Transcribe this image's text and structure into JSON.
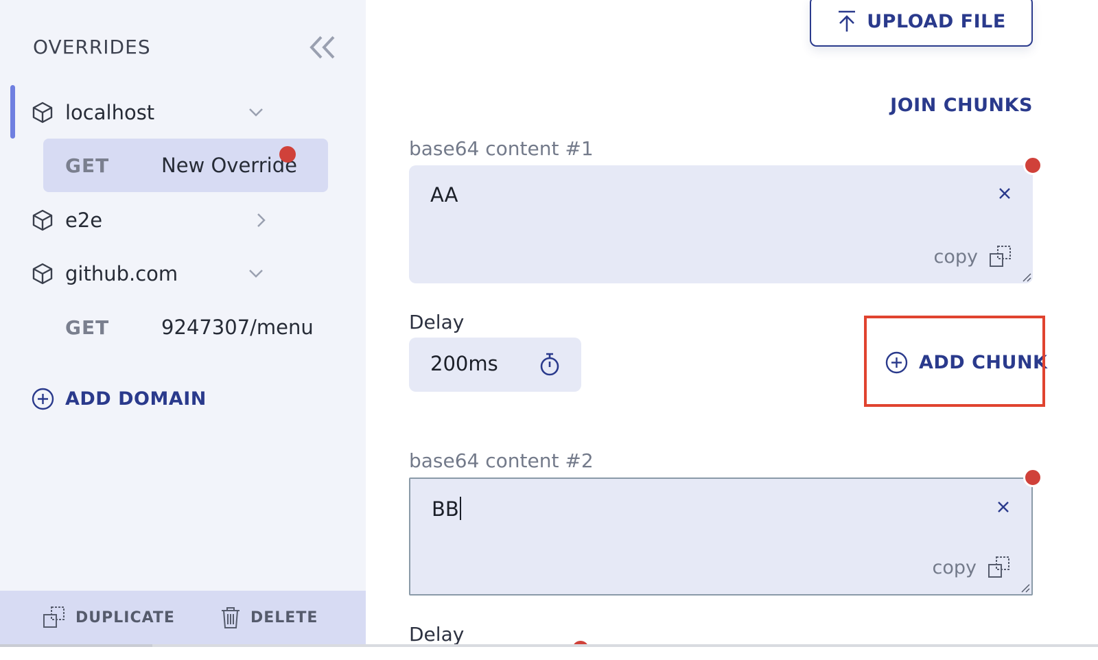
{
  "sidebar": {
    "title": "OVERRIDES",
    "domains": [
      {
        "name": "localhost",
        "expanded": true
      },
      {
        "name": "e2e",
        "expanded": false
      },
      {
        "name": "github.com",
        "expanded": true
      }
    ],
    "routes": [
      {
        "method": "GET",
        "path": "New Override",
        "selected": true,
        "has_error": true
      },
      {
        "method": "GET",
        "path": "9247307/menu",
        "selected": false,
        "has_error": false
      }
    ],
    "add_domain_label": "ADD DOMAIN",
    "footer": {
      "duplicate_label": "DUPLICATE",
      "delete_label": "DELETE"
    }
  },
  "main": {
    "upload_label": "UPLOAD FILE",
    "join_chunks_label": "JOIN CHUNKS",
    "chunks": [
      {
        "label": "base64 content #1",
        "value": "AA",
        "copy_label": "copy",
        "delay_label": "Delay",
        "delay_value": "200ms"
      },
      {
        "label": "base64 content #2",
        "value": "BB",
        "copy_label": "copy",
        "delay_label": "Delay"
      }
    ],
    "add_chunk_label": "ADD CHUNK"
  },
  "colors": {
    "accent": "#2a3a8c",
    "error": "#d0413a",
    "highlight": "#e0432f",
    "sidebar_bg": "#f2f4fa",
    "selected_bg": "#d7dbf3",
    "field_bg": "#e6e9f6"
  },
  "icons": [
    "chevrons-left-icon",
    "cube-icon",
    "chevron-down-icon",
    "chevron-right-icon",
    "plus-circle-icon",
    "duplicate-icon",
    "trash-icon",
    "upload-icon",
    "close-icon",
    "copy-icon",
    "timer-icon"
  ]
}
